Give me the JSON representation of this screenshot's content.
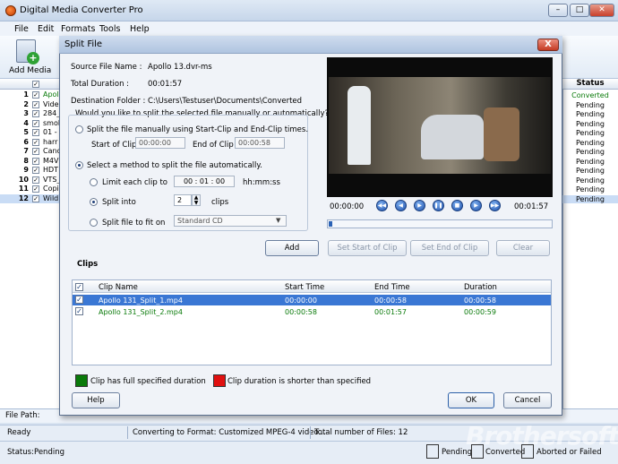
{
  "window": {
    "title": "Digital Media Converter Pro"
  },
  "menu": [
    "File",
    "Edit",
    "Formats",
    "Tools",
    "Help"
  ],
  "toolbar": {
    "add_media": "Add Media"
  },
  "file_list": {
    "rows": [
      {
        "num": "1",
        "name": "Apoll"
      },
      {
        "num": "2",
        "name": "Vide"
      },
      {
        "num": "3",
        "name": "284_"
      },
      {
        "num": "4",
        "name": "smok"
      },
      {
        "num": "5",
        "name": "01 -"
      },
      {
        "num": "6",
        "name": "harr"
      },
      {
        "num": "7",
        "name": "Canc"
      },
      {
        "num": "8",
        "name": "M4V"
      },
      {
        "num": "9",
        "name": "HDT"
      },
      {
        "num": "10",
        "name": "VTS_"
      },
      {
        "num": "11",
        "name": "Copi"
      },
      {
        "num": "12",
        "name": "Wild"
      }
    ]
  },
  "status_column": {
    "header": "Status",
    "values": [
      "Converted",
      "Pending",
      "Pending",
      "Pending",
      "Pending",
      "Pending",
      "Pending",
      "Pending",
      "Pending",
      "Pending",
      "Pending",
      "Pending"
    ]
  },
  "bottom": {
    "file_path": "File Path:",
    "ready": "Ready",
    "converting": "Converting to Format: Customized MPEG-4 video...",
    "total_files": "Total number of Files: 12",
    "status": "Status:",
    "status_value": "Pending",
    "legend": [
      {
        "label": "Pending",
        "color": "#000000"
      },
      {
        "label": "Converted",
        "color": "#0a7a0a"
      },
      {
        "label": "Aborted or Failed",
        "color": "#e01010"
      }
    ]
  },
  "dialog": {
    "title": "Split File",
    "close": "X",
    "source_label": "Source File Name :",
    "source_value": "Apollo 13.dvr-ms",
    "duration_label": "Total Duration :",
    "duration_value": "00:01:57",
    "dest_label": "Destination Folder :",
    "dest_value": "C:\\Users\\Testuser\\Documents\\Converted",
    "question": "Would you like to split the selected file manually or automatically?",
    "manual_option": "Split the file manually using Start-Clip and End-Clip times.",
    "start_clip_label": "Start of Clip",
    "start_clip_value": "00:00:00",
    "end_clip_label": "End of Clip",
    "end_clip_value": "00:00:58",
    "auto_option": "Select a method to split the file automatically.",
    "limit_label": "Limit each clip to",
    "limit_value": "00 : 01 : 00",
    "limit_unit": "hh:mm:ss",
    "split_into_label": "Split into",
    "split_into_value": "2",
    "split_into_unit": "clips",
    "fit_label": "Split file to fit on",
    "fit_value": "Standard CD",
    "add_btn": "Add",
    "set_start_btn": "Set Start of Clip",
    "set_end_btn": "Set End of Clip",
    "clear_btn": "Clear",
    "time_start": "00:00:00",
    "time_end": "00:01:57",
    "clips_title": "Clips",
    "columns": [
      "Clip Name",
      "Start Time",
      "End Time",
      "Duration"
    ],
    "clips": [
      {
        "name": "Apollo 131_Split_1.mp4",
        "start": "00:00:00",
        "end": "00:00:58",
        "duration": "00:00:58"
      },
      {
        "name": "Apollo 131_Split_2.mp4",
        "start": "00:00:58",
        "end": "00:01:57",
        "duration": "00:00:59"
      }
    ],
    "legend_full": "Clip has full specified duration",
    "legend_short": "Clip duration is shorter than specified",
    "legend_full_color": "#0a7a0a",
    "legend_short_color": "#e01010",
    "help_btn": "Help",
    "ok_btn": "OK",
    "cancel_btn": "Cancel"
  },
  "watermark": "Brothersoft"
}
